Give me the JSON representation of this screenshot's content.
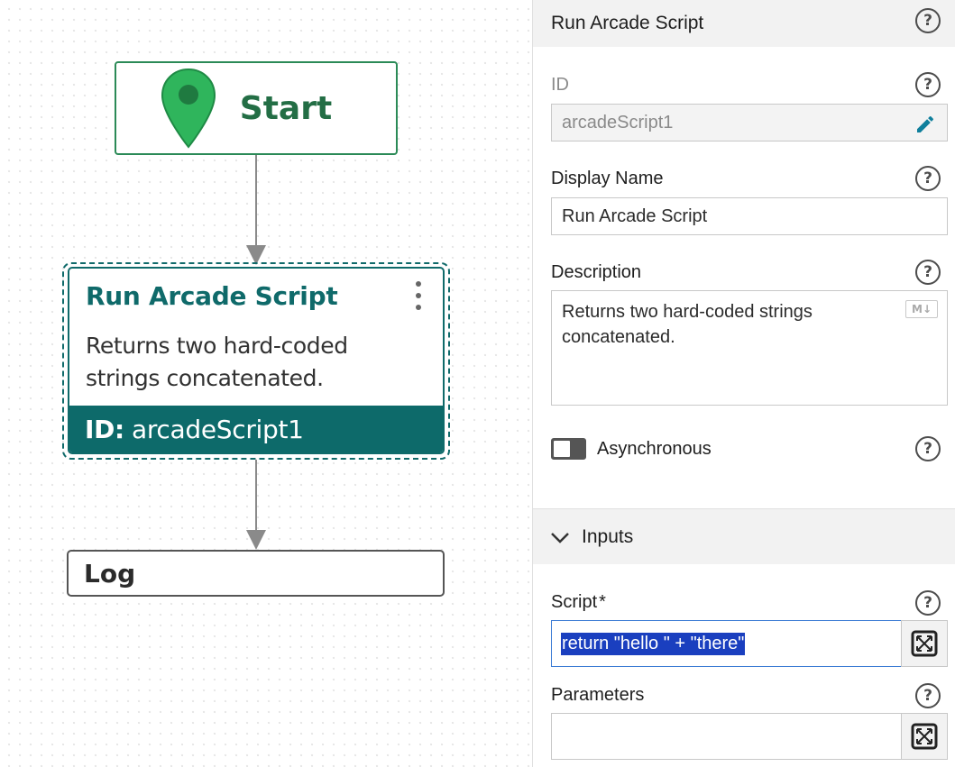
{
  "canvas": {
    "start_node": {
      "label": "Start"
    },
    "script_node": {
      "title": "Run Arcade Script",
      "description": "Returns two hard-coded strings concatenated.",
      "id_prefix": "ID:",
      "id_value": "arcadeScript1"
    },
    "log_node": {
      "label": "Log"
    }
  },
  "panel": {
    "title": "Run Arcade Script",
    "id_field": {
      "label": "ID",
      "value": "arcadeScript1"
    },
    "display_name": {
      "label": "Display Name",
      "value": "Run Arcade Script"
    },
    "description": {
      "label": "Description",
      "value": "Returns two hard-coded strings concatenated.",
      "markdown_badge": "M↓"
    },
    "asynchronous": {
      "label": "Asynchronous",
      "enabled": false
    },
    "inputs_section": {
      "label": "Inputs",
      "expanded": true
    },
    "script": {
      "label": "Script",
      "required_mark": "*",
      "value": "return \"hello \" + \"there\""
    },
    "parameters": {
      "label": "Parameters",
      "value": ""
    },
    "help_symbol": "?"
  },
  "colors": {
    "teal": "#0d6a6a",
    "start_green": "#2b8a57",
    "pin_green": "#2fb55c",
    "selection": "#1a3fbf"
  },
  "icons": [
    "map-pin-icon",
    "more-vertical-icon",
    "help-icon",
    "pencil-icon",
    "markdown-icon",
    "chevron-down-icon",
    "expand-icon"
  ]
}
